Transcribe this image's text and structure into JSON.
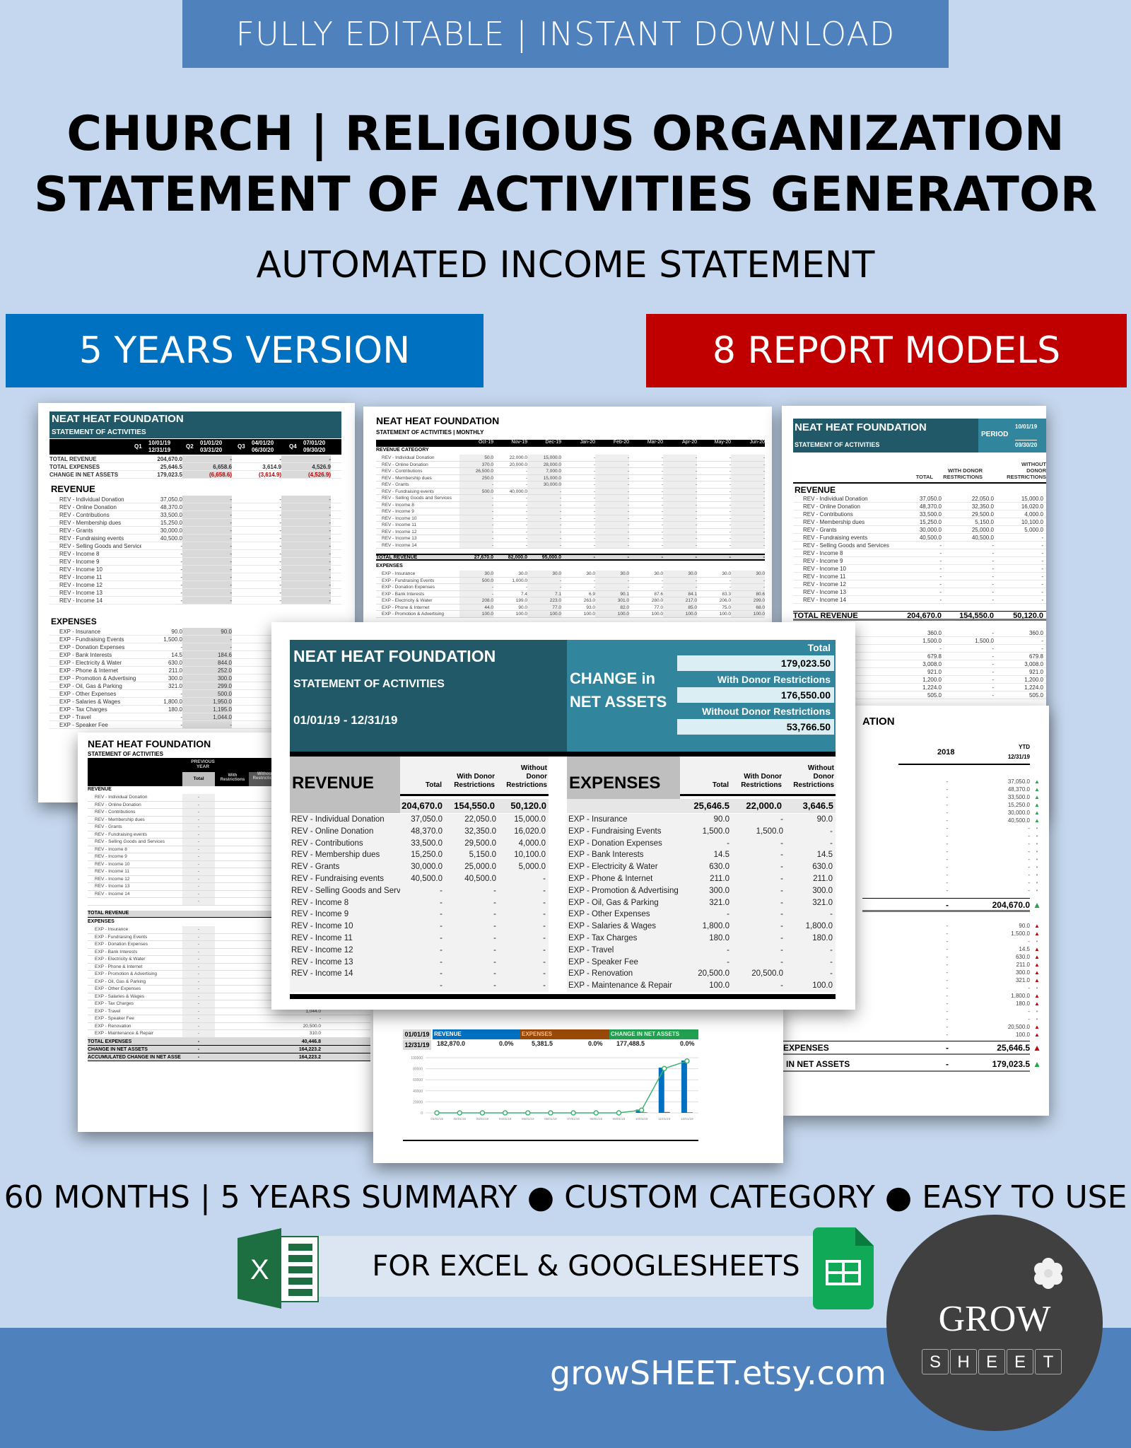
{
  "banner": {
    "top": "FULLY EDITABLE | INSTANT DOWNLOAD",
    "title_line1": "CHURCH | RELIGIOUS ORGANIZATION",
    "title_line2": "STATEMENT OF ACTIVITIES GENERATOR",
    "subtitle": "AUTOMATED INCOME STATEMENT",
    "badge_left": "5 YEARS VERSION",
    "badge_right": "8 REPORT MODELS",
    "features": "60 MONTHS | 5 YEARS SUMMARY ● CUSTOM CATEGORY ● EASY TO USE",
    "platforms": "FOR EXCEL & GOOGLESHEETS",
    "website": "growSHEET.etsy.com",
    "logo_top": "GROW",
    "logo_letters": [
      "S",
      "H",
      "E",
      "E",
      "T"
    ]
  },
  "colors": {
    "background": "#c5d7ee",
    "banner_blue": "#4f81bd",
    "badge_blue": "#0070c0",
    "badge_red": "#c00000",
    "teal_dark": "#215968",
    "teal_mid": "#31859c",
    "excel_green": "#1d6f42",
    "sheets_green": "#0fa958"
  },
  "org": {
    "name": "NEAT HEAT FOUNDATION",
    "statement": "STATEMENT OF ACTIVITIES",
    "statement_monthly": "STATEMENT OF ACTIVITIES | MONTHLY"
  },
  "main_sheet": {
    "period": "01/01/19 - 12/31/19",
    "change_label": "CHANGE in NET ASSETS",
    "change_total_label": "Total",
    "change_total": "179,023.50",
    "change_with_label": "With Donor Restrictions",
    "change_with": "176,550.00",
    "change_without_label": "Without Donor Restrictions",
    "change_without": "53,766.50",
    "col_total": "Total",
    "col_with": "With Donor Restrictions",
    "col_without": "Without Donor Restrictions",
    "revenue": {
      "label": "REVENUE",
      "totals": [
        "204,670.0",
        "154,550.0",
        "50,120.0"
      ],
      "rows": [
        [
          "REV - Individual Donation",
          "37,050.0",
          "22,050.0",
          "15,000.0"
        ],
        [
          "REV - Online Donation",
          "48,370.0",
          "32,350.0",
          "16,020.0"
        ],
        [
          "REV - Contributions",
          "33,500.0",
          "29,500.0",
          "4,000.0"
        ],
        [
          "REV - Membership dues",
          "15,250.0",
          "5,150.0",
          "10,100.0"
        ],
        [
          "REV - Grants",
          "30,000.0",
          "25,000.0",
          "5,000.0"
        ],
        [
          "REV - Fundraising events",
          "40,500.0",
          "40,500.0",
          "-"
        ],
        [
          "REV - Selling Goods and Services",
          "-",
          "-",
          "-"
        ],
        [
          "REV - Income 8",
          "-",
          "-",
          "-"
        ],
        [
          "REV - Income 9",
          "-",
          "-",
          "-"
        ],
        [
          "REV - Income 10",
          "-",
          "-",
          "-"
        ],
        [
          "REV - Income 11",
          "-",
          "-",
          "-"
        ],
        [
          "REV - Income 12",
          "-",
          "-",
          "-"
        ],
        [
          "REV - Income 13",
          "-",
          "-",
          "-"
        ],
        [
          "REV - Income 14",
          "-",
          "-",
          "-"
        ],
        [
          "",
          "-",
          "-",
          "-"
        ]
      ]
    },
    "expenses": {
      "label": "EXPENSES",
      "totals": [
        "25,646.5",
        "22,000.0",
        "3,646.5"
      ],
      "rows": [
        [
          "EXP - Insurance",
          "90.0",
          "-",
          "90.0"
        ],
        [
          "EXP - Fundraising Events",
          "1,500.0",
          "1,500.0",
          "-"
        ],
        [
          "EXP - Donation Expenses",
          "-",
          "-",
          "-"
        ],
        [
          "EXP - Bank Interests",
          "14.5",
          "-",
          "14.5"
        ],
        [
          "EXP - Electricity & Water",
          "630.0",
          "-",
          "630.0"
        ],
        [
          "EXP - Phone & Internet",
          "211.0",
          "-",
          "211.0"
        ],
        [
          "EXP - Promotion & Advertising",
          "300.0",
          "-",
          "300.0"
        ],
        [
          "EXP - Oil, Gas & Parking",
          "321.0",
          "-",
          "321.0"
        ],
        [
          "EXP - Other Expenses",
          "-",
          "-",
          "-"
        ],
        [
          "EXP - Salaries & Wages",
          "1,800.0",
          "-",
          "1,800.0"
        ],
        [
          "EXP - Tax Charges",
          "180.0",
          "-",
          "180.0"
        ],
        [
          "EXP - Travel",
          "-",
          "-",
          "-"
        ],
        [
          "EXP - Speaker Fee",
          "-",
          "-",
          "-"
        ],
        [
          "EXP - Renovation",
          "20,500.0",
          "20,500.0",
          "-"
        ],
        [
          "EXP - Maintenance & Repair",
          "100.0",
          "-",
          "100.0"
        ]
      ]
    }
  },
  "quarterly_sheet": {
    "quarters": [
      {
        "q": "Q1",
        "from": "10/01/19",
        "to": "12/31/19"
      },
      {
        "q": "Q2",
        "from": "01/01/20",
        "to": "03/31/20"
      },
      {
        "q": "Q3",
        "from": "04/01/20",
        "to": "06/30/20"
      },
      {
        "q": "Q4",
        "from": "07/01/20",
        "to": "09/30/20"
      }
    ],
    "summary": [
      [
        "TOTAL REVENUE",
        "204,670.0",
        "-",
        "-",
        "-"
      ],
      [
        "TOTAL EXPENSES",
        "25,646.5",
        "6,658.6",
        "3,614.9",
        "4,526.9"
      ],
      [
        "CHANGE IN NET ASSETS",
        "179,023.5",
        "(6,658.6)",
        "(3,614.9)",
        "(4,526.9)"
      ]
    ],
    "revenue_label": "REVENUE",
    "revenue_rows": [
      [
        "REV - Individual Donation",
        "37,050.0"
      ],
      [
        "REV - Online Donation",
        "48,370.0"
      ],
      [
        "REV - Contributions",
        "33,500.0"
      ],
      [
        "REV - Membership dues",
        "15,250.0"
      ],
      [
        "REV - Grants",
        "30,000.0"
      ],
      [
        "REV - Fundraising events",
        "40,500.0"
      ],
      [
        "REV - Selling Goods and Services",
        "-"
      ],
      [
        "REV - Income 8",
        "-"
      ],
      [
        "REV - Income 9",
        "-"
      ],
      [
        "REV - Income 10",
        "-"
      ],
      [
        "REV - Income 11",
        "-"
      ],
      [
        "REV - Income 12",
        "-"
      ],
      [
        "REV - Income 13",
        "-"
      ],
      [
        "REV - Income 14",
        "-"
      ]
    ],
    "expenses_label": "EXPENSES",
    "expense_rows": [
      [
        "EXP - Insurance",
        "90.0",
        "90.0"
      ],
      [
        "EXP - Fundraising Events",
        "1,500.0",
        "-"
      ],
      [
        "EXP - Donation Expenses",
        "-",
        "-"
      ],
      [
        "EXP - Bank Interests",
        "14.5",
        "184.6"
      ],
      [
        "EXP - Electricity & Water",
        "630.0",
        "844.0"
      ],
      [
        "EXP - Phone & Internet",
        "211.0",
        "252.0"
      ],
      [
        "EXP - Promotion & Advertising",
        "300.0",
        "300.0"
      ],
      [
        "EXP - Oil, Gas & Parking",
        "321.0",
        "299.0"
      ],
      [
        "EXP - Other Expenses",
        "-",
        "500.0"
      ],
      [
        "EXP - Salaries & Wages",
        "1,800.0",
        "1,950.0"
      ],
      [
        "EXP - Tax Charges",
        "180.0",
        "1,195.0"
      ],
      [
        "EXP - Travel",
        "-",
        "1,044.0"
      ],
      [
        "EXP - Speaker Fee",
        "-",
        "-"
      ]
    ]
  },
  "monthly_sheet": {
    "months": [
      "Oct-19",
      "Nov-19",
      "Dec-19",
      "Jan-20",
      "Feb-20",
      "Mar-20",
      "Apr-20",
      "May-20",
      "Jun-20"
    ],
    "revenue_category": "REVENUE CATEGORY",
    "revenue_rows": [
      [
        "REV - Individual Donation",
        "50.0",
        "22,000.0",
        "15,000.0"
      ],
      [
        "REV - Online Donation",
        "370.0",
        "20,000.0",
        "28,000.0"
      ],
      [
        "REV - Contributions",
        "26,500.0",
        "-",
        "7,000.0"
      ],
      [
        "REV - Membership dues",
        "250.0",
        "-",
        "15,000.0"
      ],
      [
        "REV - Grants",
        "-",
        "-",
        "30,000.0"
      ],
      [
        "REV - Fundraising events",
        "500.0",
        "40,000.0",
        "-"
      ],
      [
        "REV - Selling Goods and Services",
        "-",
        "-",
        "-"
      ],
      [
        "REV - Income 8",
        "-",
        "-",
        "-"
      ],
      [
        "REV - Income 9",
        "-",
        "-",
        "-"
      ],
      [
        "REV - Income 10",
        "-",
        "-",
        "-"
      ],
      [
        "REV - Income 11",
        "-",
        "-",
        "-"
      ],
      [
        "REV - Income 12",
        "-",
        "-",
        "-"
      ],
      [
        "REV - Income 13",
        "-",
        "-",
        "-"
      ],
      [
        "REV - Income 14",
        "-",
        "-",
        "-"
      ]
    ],
    "total_revenue": [
      "TOTAL REVENUE",
      "27,670.0",
      "82,000.0",
      "95,000.0"
    ],
    "expenses_label": "EXPENSES",
    "expense_rows": [
      [
        "EXP - Insurance",
        "30.0",
        "30.0",
        "30.0",
        "30.0",
        "30.0",
        "30.0",
        "30.0",
        "30.0",
        "30.0"
      ],
      [
        "EXP - Fundraising Events",
        "500.0",
        "1,000.0",
        "-",
        "-",
        "-",
        "-",
        "-",
        "-",
        "-"
      ],
      [
        "EXP - Donation Expenses",
        "-",
        "-",
        "-",
        "-",
        "-",
        "-",
        "-",
        "-",
        "-"
      ],
      [
        "EXP - Bank Interests",
        "-",
        "7.4",
        "7.1",
        "6.9",
        "90.1",
        "87.6",
        "84.1",
        "83.3",
        "80.6"
      ],
      [
        "EXP - Electricity & Water",
        "208.0",
        "199.0",
        "223.0",
        "263.0",
        "301.0",
        "280.0",
        "217.0",
        "206.0",
        "299.0"
      ],
      [
        "EXP - Phone & Internet",
        "44.0",
        "90.0",
        "77.0",
        "93.0",
        "82.0",
        "77.0",
        "85.0",
        "75.0",
        "68.0"
      ],
      [
        "EXP - Promotion & Advertising",
        "100.0",
        "100.0",
        "100.0",
        "100.0",
        "100.0",
        "100.0",
        "100.0",
        "100.0",
        "100.0"
      ]
    ]
  },
  "period_sheet": {
    "period_label": "PERIOD",
    "period_from": "10/01/19",
    "period_to": "09/30/20",
    "cols": [
      "TOTAL",
      "WITH DONOR RESTRICTIONS",
      "WITHOUT DONOR RESTRICTIONS"
    ],
    "revenue_label": "REVENUE",
    "rows": [
      [
        "REV - Individual Donation",
        "37,050.0",
        "22,050.0",
        "15,000.0"
      ],
      [
        "REV - Online Donation",
        "48,370.0",
        "32,350.0",
        "16,020.0"
      ],
      [
        "REV - Contributions",
        "33,500.0",
        "29,500.0",
        "4,000.0"
      ],
      [
        "REV - Membership dues",
        "15,250.0",
        "5,150.0",
        "10,100.0"
      ],
      [
        "REV - Grants",
        "30,000.0",
        "25,000.0",
        "5,000.0"
      ],
      [
        "REV - Fundraising events",
        "40,500.0",
        "40,500.0",
        "-"
      ],
      [
        "REV - Selling Goods and Services",
        "-",
        "-",
        "-"
      ],
      [
        "REV - Income 8",
        "-",
        "-",
        "-"
      ],
      [
        "REV - Income 9",
        "-",
        "-",
        "-"
      ],
      [
        "REV - Income 10",
        "-",
        "-",
        "-"
      ],
      [
        "REV - Income 11",
        "-",
        "-",
        "-"
      ],
      [
        "REV - Income 12",
        "-",
        "-",
        "-"
      ],
      [
        "REV - Income 13",
        "-",
        "-",
        "-"
      ],
      [
        "REV - Income 14",
        "-",
        "-",
        "-"
      ]
    ],
    "total_revenue": [
      "TOTAL REVENUE",
      "204,670.0",
      "154,550.0",
      "50,120.0"
    ],
    "expense_values": [
      [
        "360.0",
        "-",
        "360.0"
      ],
      [
        "1,500.0",
        "1,500.0",
        "-"
      ],
      [
        "-",
        "-",
        "-"
      ],
      [
        "679.8",
        "-",
        "679.8"
      ],
      [
        "3,008.0",
        "-",
        "3,008.0"
      ],
      [
        "921.0",
        "-",
        "921.0"
      ],
      [
        "1,200.0",
        "-",
        "1,200.0"
      ],
      [
        "1,224.0",
        "-",
        "1,224.0"
      ],
      [
        "505.0",
        "-",
        "505.0"
      ]
    ]
  },
  "ytd_sheet": {
    "title_fragment": "ATION",
    "col_prev": "2018",
    "col_ytd": "YTD",
    "col_ytd_date": "12/31/19",
    "revenue_values": [
      "37,050.0",
      "48,370.0",
      "33,500.0",
      "15,250.0",
      "30,000.0",
      "40,500.0",
      "-",
      "-",
      "-",
      "-",
      "-",
      "-",
      "-",
      "-",
      "-"
    ],
    "total_revenue": "204,670.0",
    "expense_values": [
      "90.0",
      "1,500.0",
      "-",
      "14.5",
      "630.0",
      "211.0",
      "300.0",
      "321.0",
      "-",
      "1,800.0",
      "180.0",
      "-",
      "-",
      "20,500.0",
      "100.0"
    ],
    "total_expenses_label": "EXPENSES",
    "total_expenses": "25,646.5",
    "change_label": "IN NET ASSETS",
    "change_value": "179,023.5",
    "prev_dash": "-"
  },
  "prev_year_sheet": {
    "col_prev": "PREVIOUS YEAR",
    "col_total": "Total",
    "col_with": "With Restrictions",
    "col_without": "Without Restrictions",
    "revenue_label": "REVENUE",
    "rows_rev": [
      "REV - Individual Donation",
      "REV - Online Donation",
      "REV - Contributions",
      "REV - Membership dues",
      "REV - Grants",
      "REV - Fundraising events",
      "REV - Selling Goods and Services",
      "REV - Income 8",
      "REV - Income 9",
      "REV - Income 10",
      "REV - Income 11",
      "REV - Income 12",
      "REV - Income 13",
      "REV - Income 14",
      ""
    ],
    "total_revenue": "TOTAL REVENUE",
    "expenses_label": "EXPENSES",
    "rows_exp": [
      "EXP - Insurance",
      "EXP - Fundraising Events",
      "EXP - Donation Expenses",
      "EXP - Bank Interests",
      "EXP - Electricity & Water",
      "EXP - Phone & Internet",
      "EXP - Promotion & Advertising",
      "EXP - Oil, Gas & Parking",
      "EXP - Other Expenses",
      "EXP - Salaries & Wages",
      "EXP - Tax Charges",
      "EXP - Travel",
      "EXP - Speaker Fee",
      "EXP - Renovation",
      "EXP - Maintenance & Repair"
    ],
    "exp_right": [
      "",
      "",
      "",
      "",
      "",
      "",
      "",
      "",
      "",
      "",
      "",
      "1,044.0",
      "-",
      "20,500.0",
      "310.0"
    ],
    "total_expenses": [
      "TOTAL EXPENSES",
      "-",
      "40,446.8"
    ],
    "change": [
      "CHANGE IN NET ASSETS",
      "-",
      "164,223.2"
    ],
    "accum": [
      "ACCUMULATED CHANGE IN NET ASSE",
      "-",
      "164,223.2"
    ]
  },
  "chart_data": {
    "type": "bar",
    "title": "",
    "header": {
      "from": "01/01/19",
      "to": "12/31/19",
      "revenue_label": "REVENUE",
      "revenue_value": "182,870.0",
      "revenue_pct": "0.0%",
      "expenses_label": "EXPENSES",
      "expenses_value": "5,381.5",
      "expenses_pct": "0.0%",
      "change_label": "CHANGE IN NET ASSETS",
      "change_value": "177,488.5",
      "change_pct": "0.0%"
    },
    "categories": [
      "01/01/19",
      "02/01/19",
      "03/01/19",
      "04/01/19",
      "05/01/19",
      "06/01/19",
      "07/01/19",
      "08/01/19",
      "09/01/19",
      "10/01/19",
      "11/01/19",
      "12/01/19"
    ],
    "series": [
      {
        "name": "Revenue",
        "kind": "bar",
        "color": "#0070c0",
        "values": [
          0,
          0,
          0,
          0,
          0,
          0,
          0,
          0,
          0,
          5870,
          82000,
          95000
        ]
      },
      {
        "name": "Expenses",
        "kind": "bar",
        "color": "#a0522d",
        "values": [
          0,
          0,
          0,
          0,
          0,
          0,
          0,
          0,
          0,
          1000,
          1600,
          1000
        ]
      },
      {
        "name": "Change in Net Assets",
        "kind": "line",
        "color": "#3cb371",
        "values": [
          0,
          0,
          0,
          0,
          0,
          0,
          0,
          0,
          0,
          4870,
          80400,
          94000
        ]
      }
    ],
    "yticks": [
      0,
      20000,
      40000,
      60000,
      80000,
      100000
    ],
    "ylim": [
      0,
      100000
    ],
    "xlabel": "",
    "ylabel": "",
    "grid": true
  }
}
